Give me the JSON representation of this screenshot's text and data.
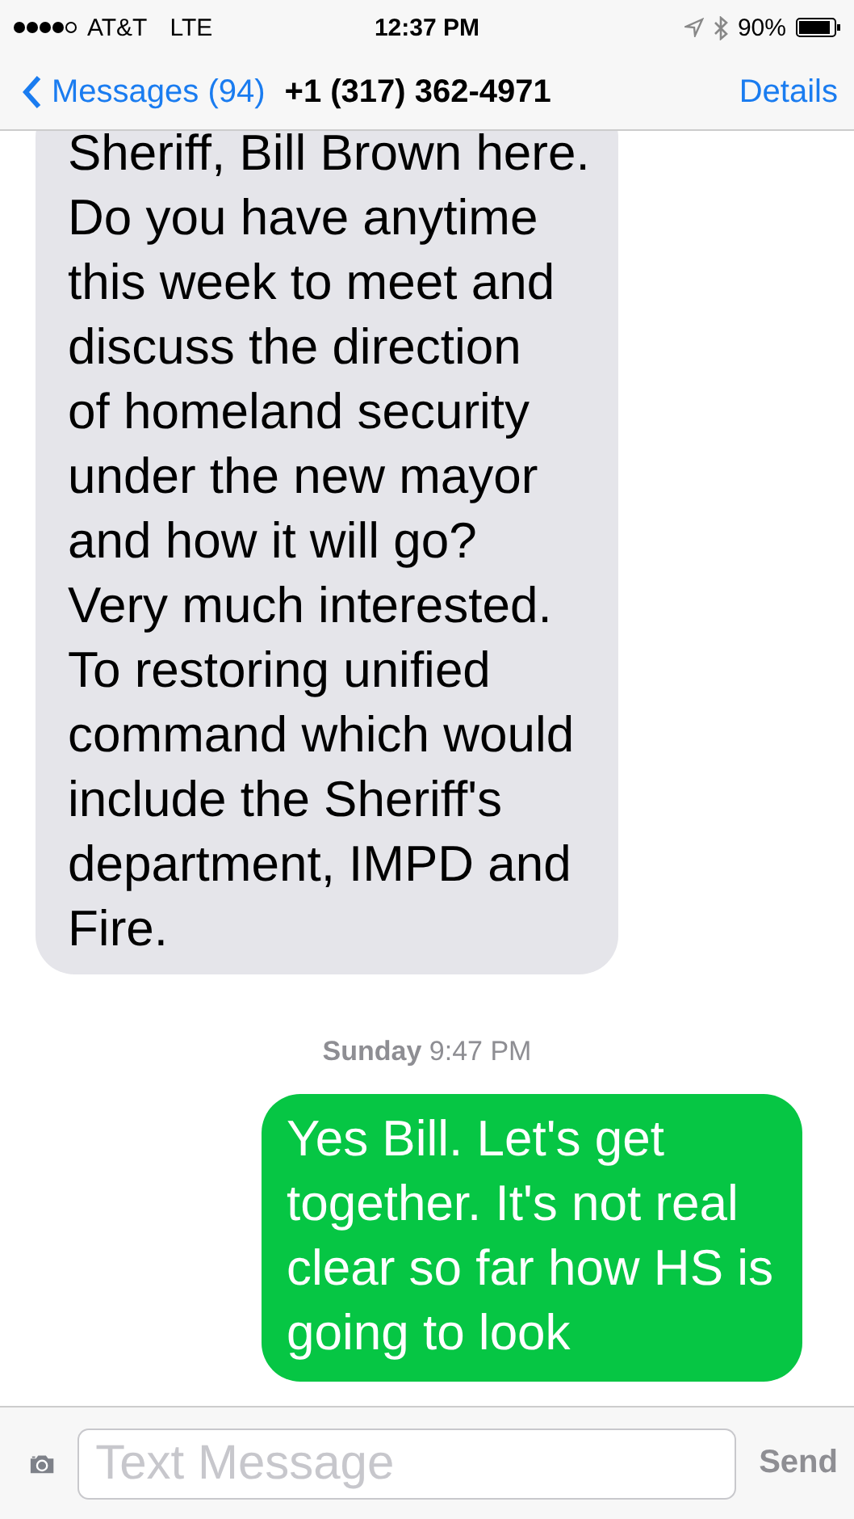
{
  "status_bar": {
    "carrier": "AT&T",
    "network": "LTE",
    "time": "12:37 PM",
    "battery": "90%"
  },
  "nav_bar": {
    "back": "Messages (94)",
    "title": "+1 (317) 362-4971",
    "action": "Details"
  },
  "messages": [
    {
      "kind": "incoming",
      "text": "Sheriff, Bill Brown here.\nDo you have anytime\nthis week to meet and\ndiscuss the direction\nof homeland security\nunder the new mayor\nand how it will go?\nVery much interested.\nTo restoring unified\ncommand which would\ninclude the Sheriff's\ndepartment, IMPD and\nFire."
    },
    {
      "kind": "timestamp",
      "text": "**Sunday** 9:47 PM"
    },
    {
      "kind": "outgoing",
      "text": "Yes Bill. Let's get\ntogether. It's not real\nclear so far how HS is\ngoing to look"
    }
  ],
  "composer": {
    "placeholder": "Text Message",
    "send": "Send"
  }
}
